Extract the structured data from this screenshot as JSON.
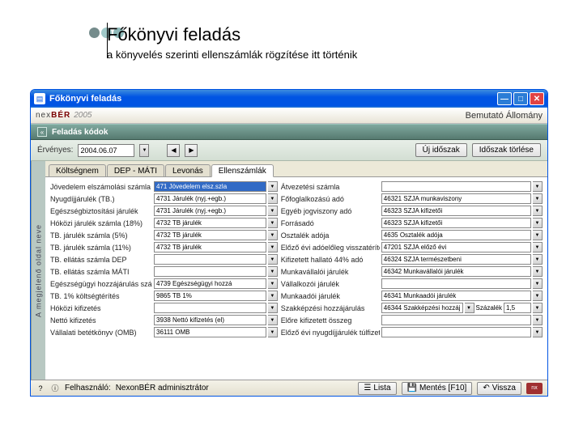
{
  "slide": {
    "title": "Főkönyvi feladás",
    "subtitle": "a könyvelés szerinti ellenszámlák rögzítése itt történik"
  },
  "window": {
    "title": "Főkönyvi feladás"
  },
  "brand": {
    "logo_prefix": "nex",
    "logo_bold": "BÉR",
    "year": "2005",
    "right": "Bemutató Állomány"
  },
  "section": {
    "title": "Feladás kódok"
  },
  "filter": {
    "label": "Érvényes:",
    "date": "2004.06.07",
    "btn_new": "Új időszak",
    "btn_del": "Időszak törlése"
  },
  "sidetab": "A megjelenő oldal neve",
  "tabs": [
    "Költségnem",
    "DEP - MÁTI",
    "Levonás",
    "Ellenszámlák"
  ],
  "left_rows": [
    {
      "label": "Jövedelem elszámolási számla",
      "value": "471 Jövedelem elsz.szla",
      "sel": true
    },
    {
      "label": "Nyugdíjjárulék (TB.)",
      "value": "4731 Járulék (nyj.+egb.)",
      "sel": false
    },
    {
      "label": "Egészségbiztosítási járulék",
      "value": "4731 Járulék (nyj.+egb.)",
      "sel": false
    },
    {
      "label": "Hóközi járulék számla (18%)",
      "value": "4732 TB járulék",
      "sel": false
    },
    {
      "label": "TB. járulék számla (5%)",
      "value": "4732 TB járulék",
      "sel": false
    },
    {
      "label": "TB. járulék számla (11%)",
      "value": "4732 TB járulék",
      "sel": false
    },
    {
      "label": "TB. ellátás számla DEP",
      "value": "",
      "sel": false
    },
    {
      "label": "TB. ellátás számla MÁTI",
      "value": "",
      "sel": false
    },
    {
      "label": "Egészségügyi hozzájárulás számla",
      "value": "4739 Egészségügyi hozzá",
      "sel": false
    },
    {
      "label": "TB. 1% költségtérítés",
      "value": "9865 TB 1%",
      "sel": false
    },
    {
      "label": "Hóközi kifizetés",
      "value": "",
      "sel": false
    },
    {
      "label": "Nettó kifizetés",
      "value": "3938 Nettó kifizetés (el)",
      "sel": false
    },
    {
      "label": "Vállalati betétkönyv (OMB)",
      "value": "36111 OMB",
      "sel": false
    }
  ],
  "right_rows": [
    {
      "label": "Átvezetési számla",
      "value": ""
    },
    {
      "label": "Főfoglalkozású adó",
      "value": "46321 SZJA munkaviszony"
    },
    {
      "label": "Egyéb jogviszony adó",
      "value": "46323 SZJA kifizetői"
    },
    {
      "label": "Forrásadó",
      "value": "46323 SZJA kifizetői"
    },
    {
      "label": "Osztalék adója",
      "value": "4635 Osztalék adója"
    },
    {
      "label": "Előző évi adóelőleg visszatérítés",
      "value": "47201 SZJA előző évi"
    },
    {
      "label": "Kifizetett hallató 44% adó",
      "value": "46324 SZJA természetbeni"
    },
    {
      "label": "Munkavállalói járulék",
      "value": "46342 Munkavállalói járulék"
    },
    {
      "label": "Vállalkozói járulék",
      "value": ""
    },
    {
      "label": "Munkaadói járulék",
      "value": "46341 Munkaadói járulék"
    },
    {
      "label": "Szakképzési hozzájárulás",
      "value": "46344 Szakképzési hozzáj",
      "extra_label": "Százalék",
      "extra_value": "1,5"
    },
    {
      "label": "Előre kifizetett összeg",
      "value": ""
    },
    {
      "label": "Előző évi nyugdíjjárulék túlfizetés",
      "value": ""
    }
  ],
  "status": {
    "user_label": "Felhasználó:",
    "user": "NexonBÉR adminisztrátor",
    "list": "Lista",
    "save": "Mentés [F10]",
    "back": "Vissza"
  }
}
